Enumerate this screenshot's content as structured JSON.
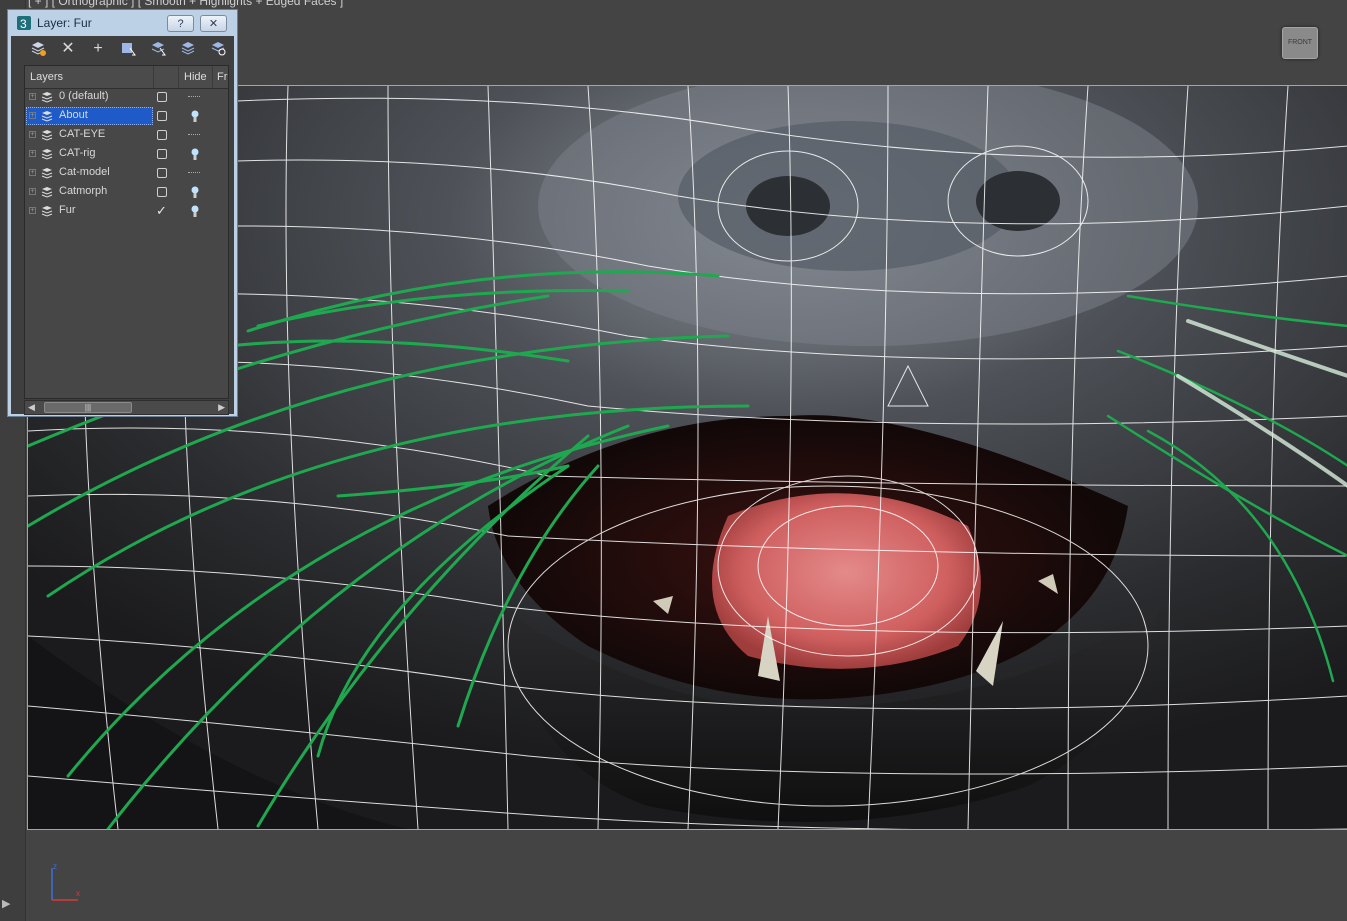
{
  "viewport": {
    "label": "[ + ] [ Orthographic ] [ Smooth + Highlights + Edged Faces ]",
    "viewcube_label": "FRONT",
    "axis": {
      "z": "z",
      "x": "x"
    }
  },
  "layer_window": {
    "title": "Layer: Fur",
    "help_button": "?",
    "close_button": "✕",
    "toolbar": {
      "new_layer": "new-layer-icon",
      "delete": "✕",
      "add_selected": "+",
      "select_objects": "select-objects-icon",
      "highlight_selected": "highlight-icon",
      "hide_all": "hide-all-icon",
      "freeze_all": "freeze-all-icon"
    },
    "columns": {
      "layers": "Layers",
      "hide": "Hide",
      "freeze": "Fr"
    },
    "layers": [
      {
        "name": "0 (default)",
        "expand": "+",
        "hide_state": "box",
        "render_state": "dash",
        "selected": false
      },
      {
        "name": "About",
        "expand": "+",
        "hide_state": "box",
        "render_state": "bulb",
        "selected": true
      },
      {
        "name": "CAT-EYE",
        "expand": "+",
        "hide_state": "box",
        "render_state": "dash",
        "selected": false
      },
      {
        "name": "CAT-rig",
        "expand": "+",
        "hide_state": "box",
        "render_state": "bulb",
        "selected": false
      },
      {
        "name": "Cat-model",
        "expand": "+",
        "hide_state": "box",
        "render_state": "dash",
        "selected": false
      },
      {
        "name": "Catmorph",
        "expand": "+",
        "hide_state": "box",
        "render_state": "bulb",
        "selected": false
      },
      {
        "name": "Fur",
        "expand": "+",
        "hide_state": "check",
        "render_state": "bulb",
        "selected": false
      }
    ],
    "scrollbar_grip": "|||"
  },
  "colors": {
    "viewport_border": "#c8b400",
    "selection": "#1e5bc8",
    "whisker_green": "#1fa84f",
    "wire": "#ffffff",
    "tongue": "#d46a6a"
  }
}
